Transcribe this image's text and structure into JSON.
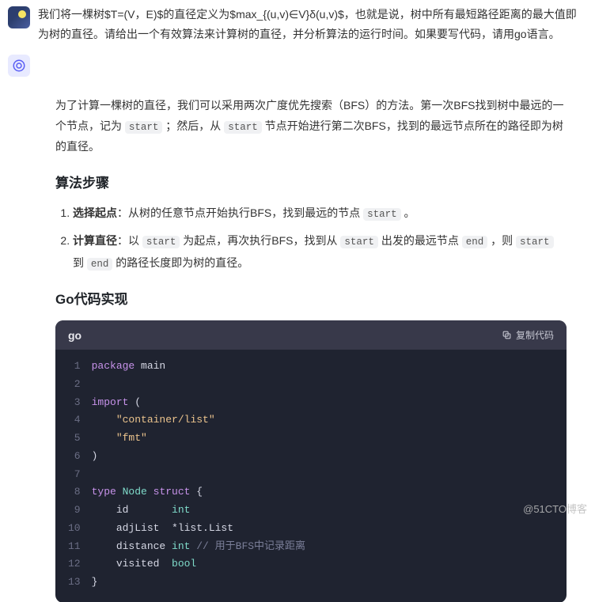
{
  "user": {
    "text": "我们将一棵树$T=(V，E)$的直径定义为$max_{(u,v)∈V}δ(u,v)$，也就是说，树中所有最短路径距离的最大值即为树的直径。请给出一个有效算法来计算树的直径，并分析算法的运行时间。如果要写代码，请用go语言。"
  },
  "answer": {
    "para": {
      "t1": "为了计算一棵树的直径，我们可以采用两次广度优先搜索（BFS）的方法。第一次BFS找到树中最远的一个节点，记为 ",
      "c1": "start",
      "t2": " ；然后，从 ",
      "c2": "start",
      "t3": " 节点开始进行第二次BFS，找到的最远节点所在的路径即为树的直径。"
    },
    "h_steps": "算法步骤",
    "steps": [
      {
        "b": "选择起点",
        "pre": "：从树的任意节点开始执行BFS，找到最远的节点 ",
        "c1": "start",
        "post": " 。"
      },
      {
        "b": "计算直径",
        "pre": "：以 ",
        "c1": "start",
        "mid1": " 为起点，再次执行BFS，找到从 ",
        "c2": "start",
        "mid2": " 出发的最远节点 ",
        "c3": "end",
        "mid3": " ，则 ",
        "c4": "start",
        "mid4": " 到 ",
        "c5": "end",
        "post": " 的路径长度即为树的直径。"
      }
    ],
    "h_code": "Go代码实现",
    "code": {
      "lang": "go",
      "copy": "复制代码",
      "linenos": "1\n2\n3\n4\n5\n6\n7\n8\n9\n10\n11\n12\n13",
      "tokens": {
        "kw_package": "package",
        "id_main": " main",
        "kw_import": "import",
        "str_container": "\"container/list\"",
        "str_fmt": "\"fmt\"",
        "kw_type": "type",
        "id_Node": " Node ",
        "kw_struct": "struct",
        "id_id": "    id       ",
        "typ_int1": "int",
        "id_adj": "    adjList  *list.List",
        "id_dist": "    distance ",
        "typ_int2": "int",
        "cm_dist": " // 用于BFS中记录距离",
        "id_vis": "    visited  ",
        "typ_bool": "bool"
      }
    }
  },
  "watermark": "@51CTO博客"
}
